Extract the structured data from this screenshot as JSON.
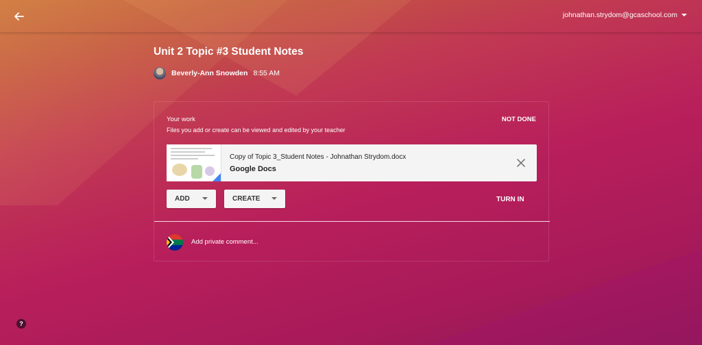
{
  "header": {
    "account_email": "johnathan.strydom@gcaschool.com",
    "back_icon": "arrow-left-icon",
    "account_menu_icon": "caret-down-icon"
  },
  "assignment": {
    "title": "Unit 2 Topic #3 Student Notes",
    "author": "Beverly-Ann Snowden",
    "time": "8:55 AM"
  },
  "work": {
    "heading": "Your work",
    "subtext": "Files you add or create can be viewed and edited by your teacher",
    "status": "NOT DONE",
    "attachment": {
      "file_name": "Copy of Topic 3_Student Notes - Johnathan Strydom.docx",
      "file_type": "Google Docs",
      "remove_icon": "close-icon"
    },
    "add_label": "ADD",
    "create_label": "CREATE",
    "turn_in_label": "TURN IN"
  },
  "comment": {
    "placeholder": "Add private comment..."
  },
  "help": {
    "label": "?"
  },
  "colors": {
    "bg_top": "#c8703a",
    "bg_mid": "#b81f5b",
    "bg_bottom": "#8e1a55",
    "button_bg": "#f4f4f4",
    "docs_blue": "#4285f4"
  }
}
